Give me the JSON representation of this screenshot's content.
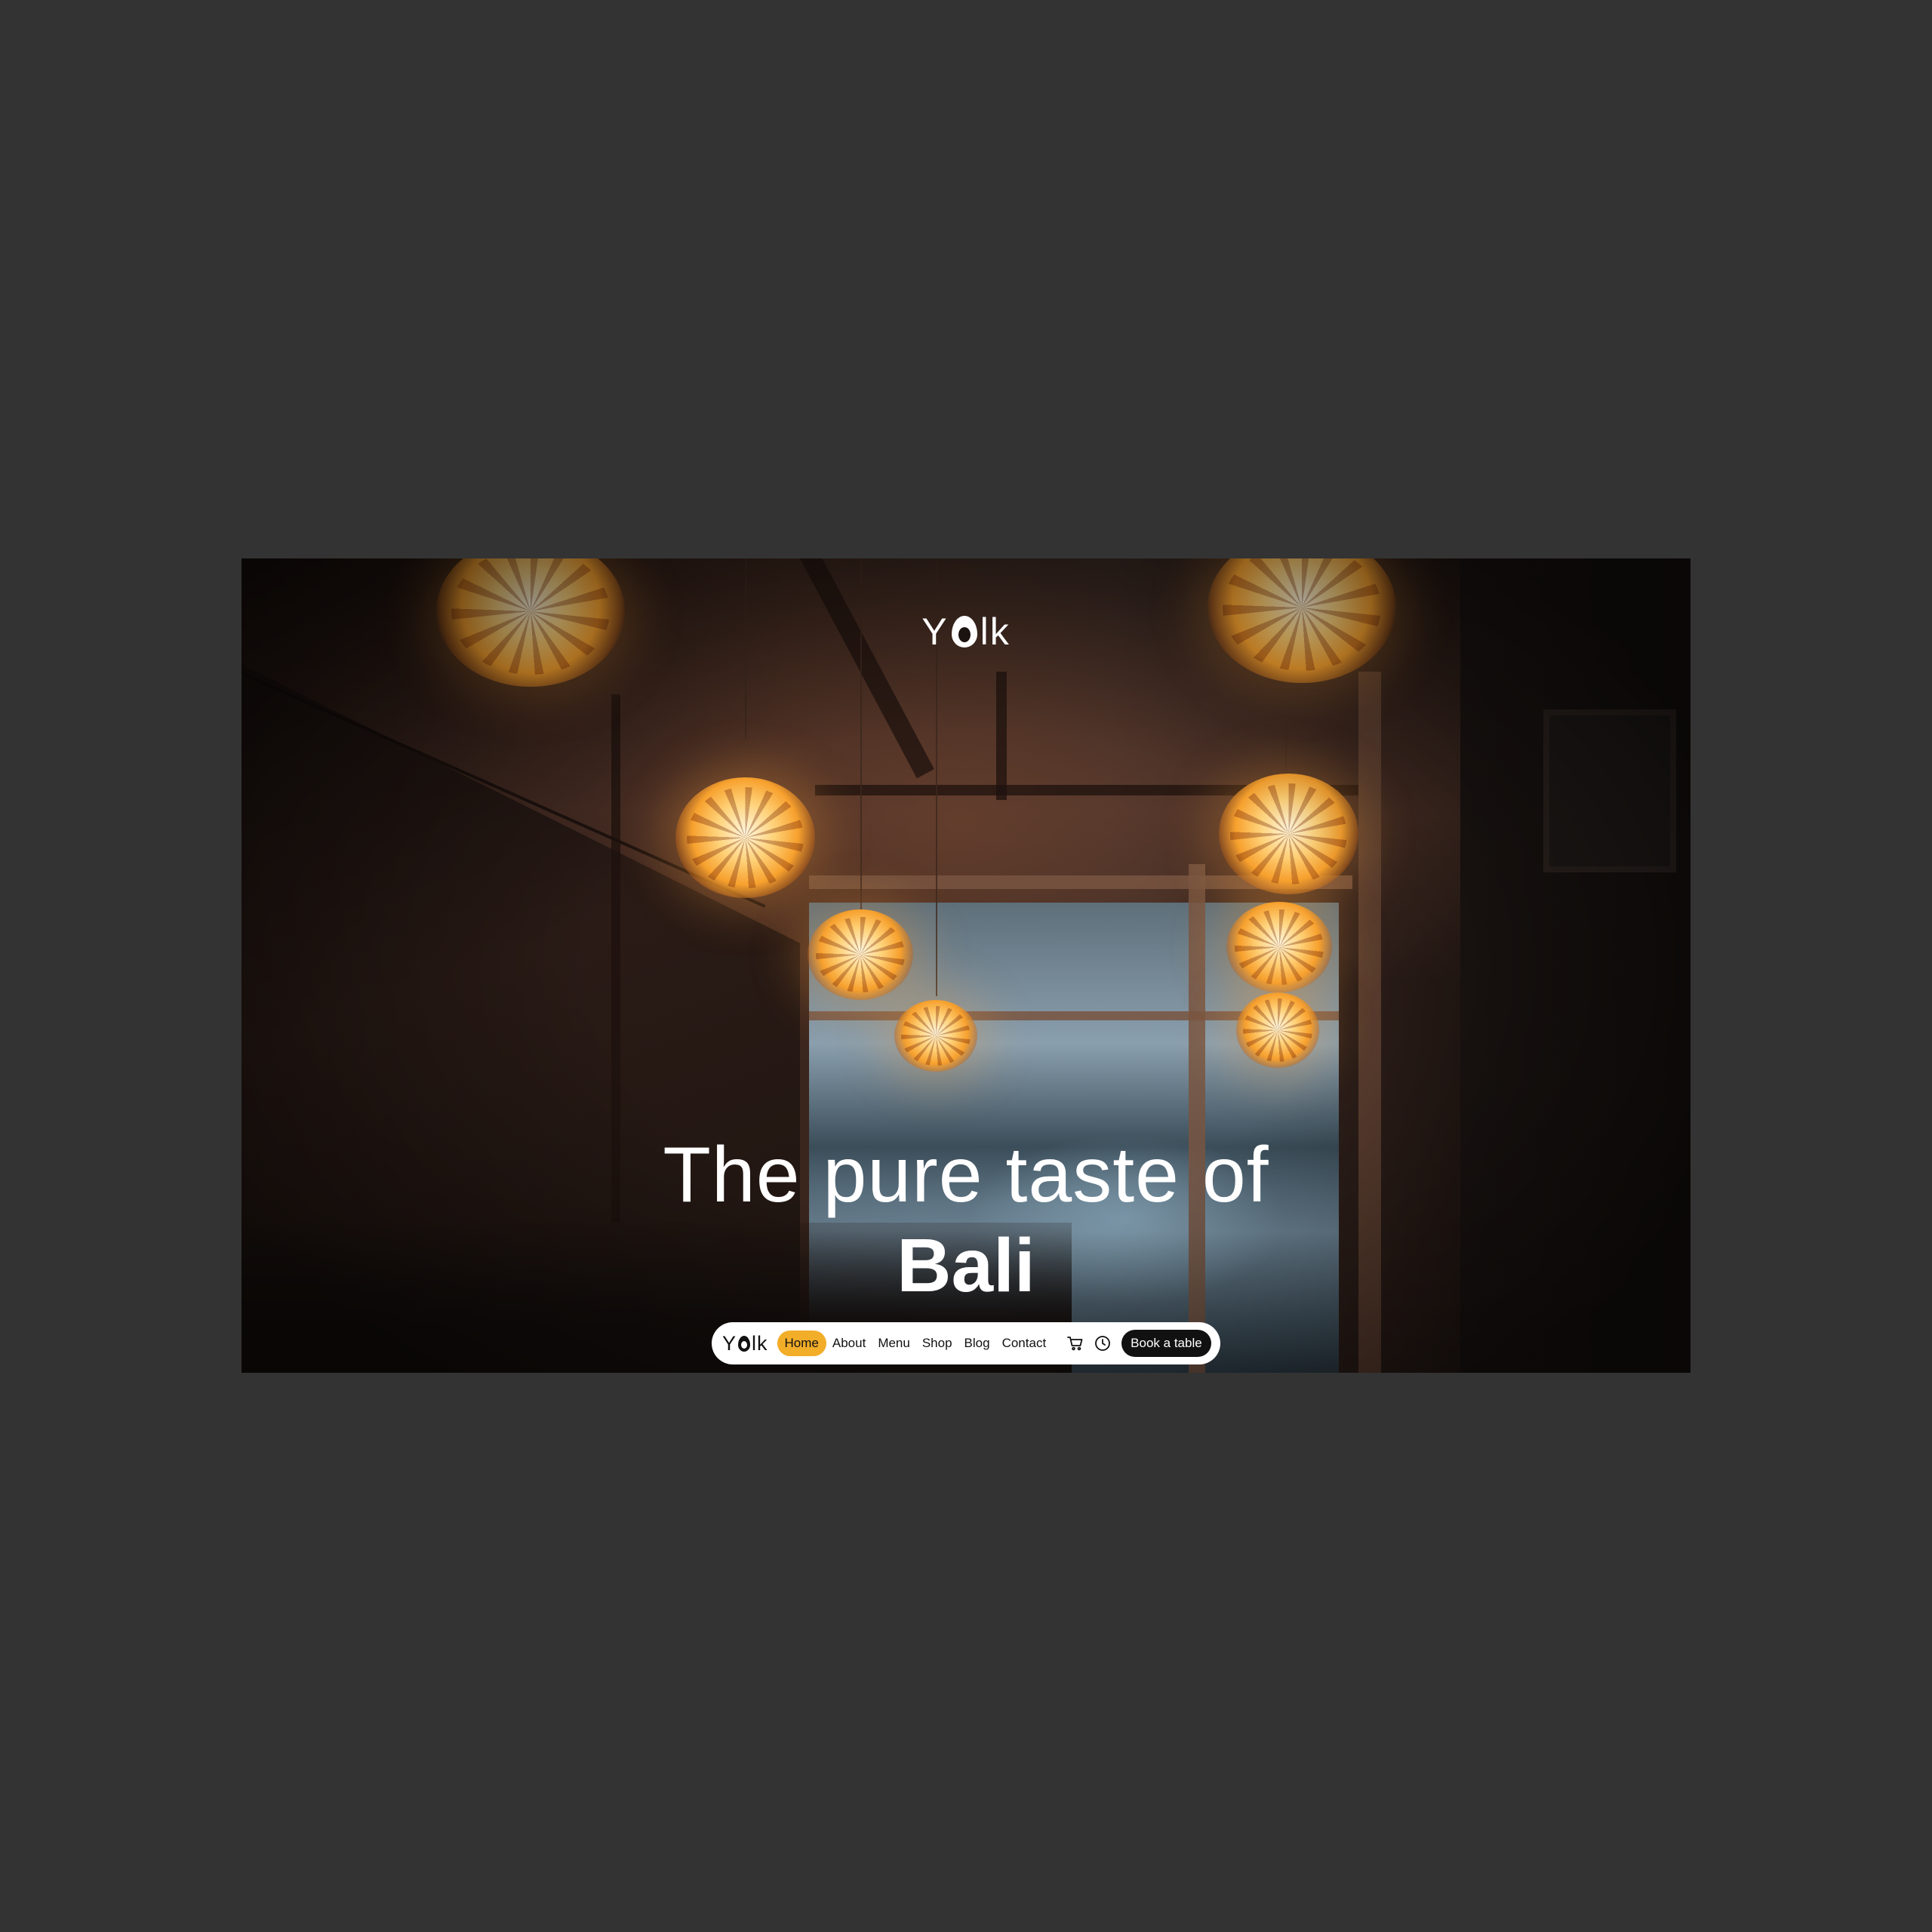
{
  "brand": {
    "logo_prefix": "Y",
    "logo_suffix": "lk",
    "logo_icon": "egg-icon"
  },
  "hero": {
    "headline_line1": "The pure taste of",
    "headline_line2": "Bali",
    "background_image": "cafe-interior-with-pendant-lamps"
  },
  "nav": {
    "items": [
      {
        "label": "Home",
        "active": true
      },
      {
        "label": "About",
        "active": false
      },
      {
        "label": "Menu",
        "active": false
      },
      {
        "label": "Shop",
        "active": false
      },
      {
        "label": "Blog",
        "active": false
      },
      {
        "label": "Contact",
        "active": false
      }
    ],
    "icons": [
      "cart-icon",
      "clock-icon"
    ],
    "cta_label": "Book a table"
  },
  "colors": {
    "page_background": "#333333",
    "accent": "#f2ad29",
    "nav_background": "#ffffff",
    "cta_background": "#111111",
    "text_light": "#ffffff"
  }
}
